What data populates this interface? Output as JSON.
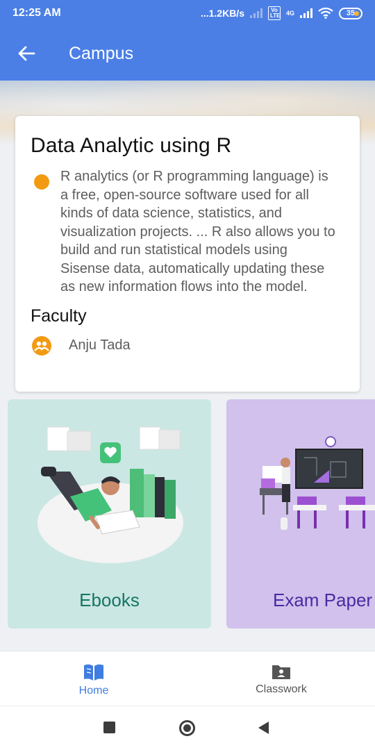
{
  "status_bar": {
    "time": "12:25 AM",
    "network_speed": "...1.2KB/s",
    "volte": "Vo LTE",
    "network_type": "4G",
    "battery_level": "35"
  },
  "app_bar": {
    "title": "Campus",
    "back_icon": "arrow-left-icon"
  },
  "course": {
    "title": "Data Analytic using R",
    "description": "R analytics (or R programming language) is a free, open-source software used for all kinds of data science, statistics, and visualization projects. ... R also allows you to build and run statistical models using Sisense data, automatically updating these as new information flows into the model.",
    "faculty_heading": "Faculty",
    "faculty_name": "Anju Tada"
  },
  "tiles": [
    {
      "label": "Ebooks",
      "color": "#cbe7e3",
      "label_color": "#167563"
    },
    {
      "label": "Exam Paper",
      "color": "#d1c1ec",
      "label_color": "#4a2aa2"
    }
  ],
  "bottom_nav": {
    "items": [
      {
        "label": "Home",
        "icon": "book-open-icon",
        "active": true
      },
      {
        "label": "Classwork",
        "icon": "folder-person-icon",
        "active": false
      }
    ]
  },
  "colors": {
    "primary": "#4b7fe6",
    "accent_orange": "#f29a12",
    "nav_active": "#3f7de0"
  }
}
